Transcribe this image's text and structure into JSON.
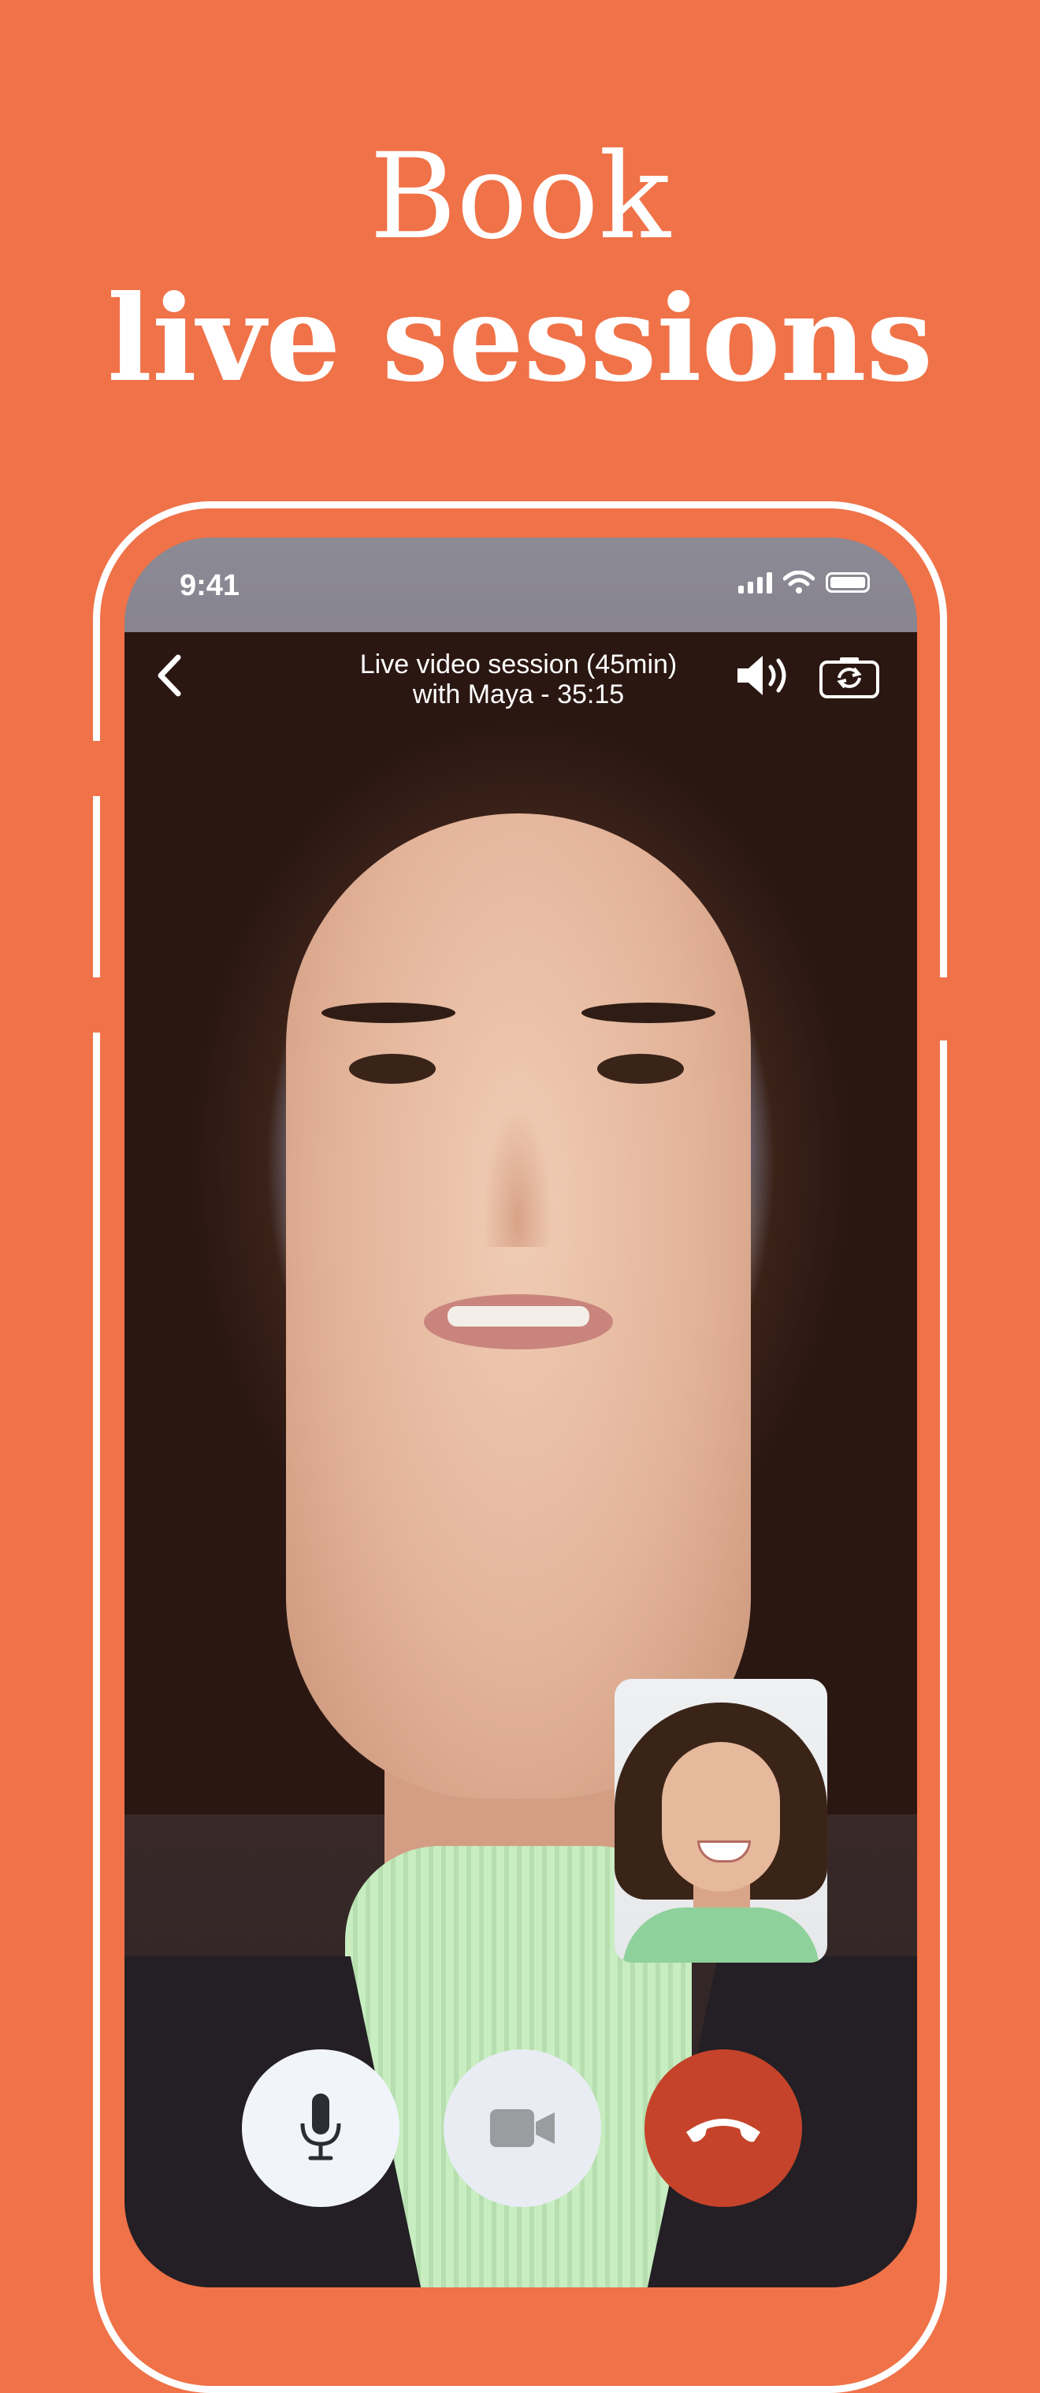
{
  "headline": {
    "line1": "Book",
    "line2": "live sessions"
  },
  "status_bar": {
    "time": "9:41",
    "icons": [
      "cellular-signal-icon",
      "wifi-icon",
      "battery-icon"
    ]
  },
  "call": {
    "title_line1": "Live video session (45min)",
    "title_line2": "with Maya - 35:15",
    "back_icon": "chevron-left-icon",
    "speaker_icon": "speaker-volume-icon",
    "flip_camera_icon": "camera-flip-icon"
  },
  "controls": [
    {
      "name": "microphone",
      "icon": "microphone-icon",
      "color": "#F1F4FB"
    },
    {
      "name": "video",
      "icon": "video-camera-icon",
      "color": "#E9ECF3"
    },
    {
      "name": "end-call",
      "icon": "phone-hangup-icon",
      "color": "#C5432A"
    }
  ],
  "colors": {
    "background": "#F07248",
    "headline": "#FFFFFF",
    "end_call": "#C5432A"
  }
}
